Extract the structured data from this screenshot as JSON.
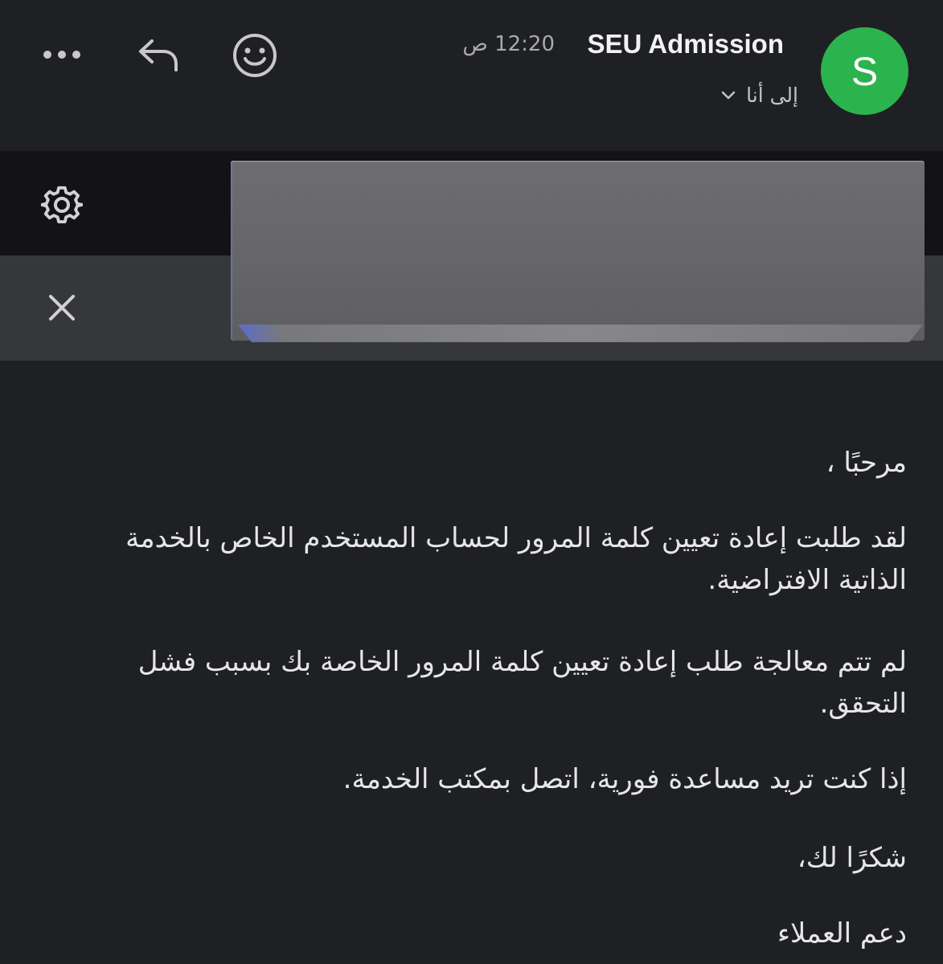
{
  "header": {
    "avatar_letter": "S",
    "avatar_color": "#2bb34e",
    "sender_name": "SEU Admission",
    "time": "12:20 ص",
    "recipient_label": "إلى أنا",
    "icons": [
      "more-horizontal-icon",
      "reply-icon",
      "emoji-icon",
      "chevron-down-icon"
    ]
  },
  "toolbar": {
    "icons": [
      "gear-icon",
      "close-icon"
    ]
  },
  "message": {
    "greeting": "مرحبًا ،",
    "paragraph1": "لقد طلبت إعادة تعيين كلمة المرور لحساب المستخدم الخاص بالخدمة الذاتية الافتراضية.",
    "paragraph2": "لم تتم معالجة طلب إعادة تعيين كلمة المرور الخاصة بك بسبب فشل التحقق.",
    "paragraph3": "إذا كنت تريد مساعدة فورية، اتصل بمكتب الخدمة.",
    "thanks": "شكرًا لك،",
    "signature": "دعم العملاء"
  }
}
